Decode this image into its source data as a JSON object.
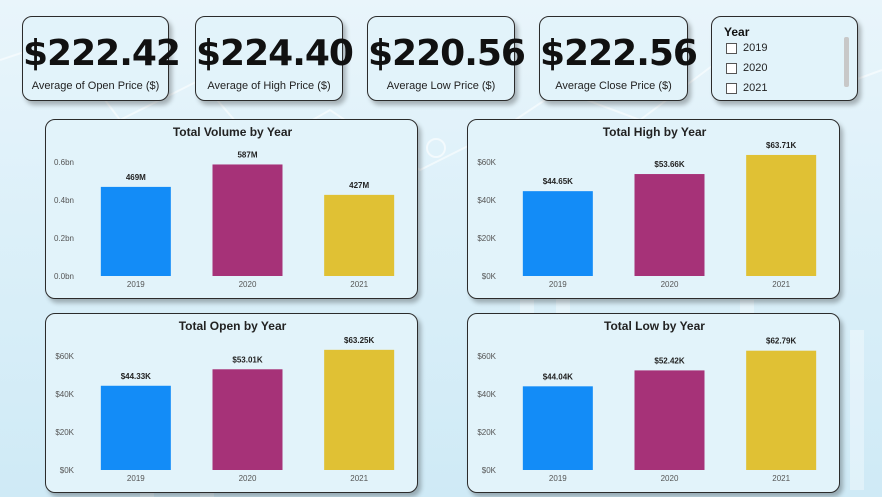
{
  "kpis": [
    {
      "value": "$222.42",
      "label": "Average of Open Price ($)"
    },
    {
      "value": "$224.40",
      "label": "Average of High Price ($)"
    },
    {
      "value": "$220.56",
      "label": "Average Low Price ($)"
    },
    {
      "value": "$222.56",
      "label": "Average Close Price ($)"
    }
  ],
  "slicer": {
    "title": "Year",
    "options": [
      "2019",
      "2020",
      "2021"
    ]
  },
  "colors": {
    "2019": "#138cf7",
    "2020": "#a63278",
    "2021": "#e0c134",
    "background": "#e2f3fa"
  },
  "chart_data": [
    {
      "type": "bar",
      "title": "Total Volume by Year",
      "categories": [
        "2019",
        "2020",
        "2021"
      ],
      "values": [
        469000000,
        587000000,
        427000000
      ],
      "data_labels": [
        "469M",
        "587M",
        "427M"
      ],
      "yticks": [
        "0.0bn",
        "0.2bn",
        "0.4bn",
        "0.6bn"
      ],
      "ytick_values": [
        0,
        200000000,
        400000000,
        600000000
      ],
      "ylim": [
        0,
        600000000
      ],
      "grid": false
    },
    {
      "type": "bar",
      "title": "Total High by Year",
      "categories": [
        "2019",
        "2020",
        "2021"
      ],
      "values": [
        44650,
        53660,
        63710
      ],
      "data_labels": [
        "$44.65K",
        "$53.66K",
        "$63.71K"
      ],
      "yticks": [
        "$0K",
        "$20K",
        "$40K",
        "$60K"
      ],
      "ytick_values": [
        0,
        20000,
        40000,
        60000
      ],
      "ylim": [
        0,
        60000
      ],
      "grid": false
    },
    {
      "type": "bar",
      "title": "Total Open by Year",
      "categories": [
        "2019",
        "2020",
        "2021"
      ],
      "values": [
        44330,
        53010,
        63250
      ],
      "data_labels": [
        "$44.33K",
        "$53.01K",
        "$63.25K"
      ],
      "yticks": [
        "$0K",
        "$20K",
        "$40K",
        "$60K"
      ],
      "ytick_values": [
        0,
        20000,
        40000,
        60000
      ],
      "ylim": [
        0,
        60000
      ],
      "grid": false
    },
    {
      "type": "bar",
      "title": "Total Low by Year",
      "categories": [
        "2019",
        "2020",
        "2021"
      ],
      "values": [
        44040,
        52420,
        62790
      ],
      "data_labels": [
        "$44.04K",
        "$52.42K",
        "$62.79K"
      ],
      "yticks": [
        "$0K",
        "$20K",
        "$40K",
        "$60K"
      ],
      "ytick_values": [
        0,
        20000,
        40000,
        60000
      ],
      "ylim": [
        0,
        60000
      ],
      "grid": false
    }
  ]
}
